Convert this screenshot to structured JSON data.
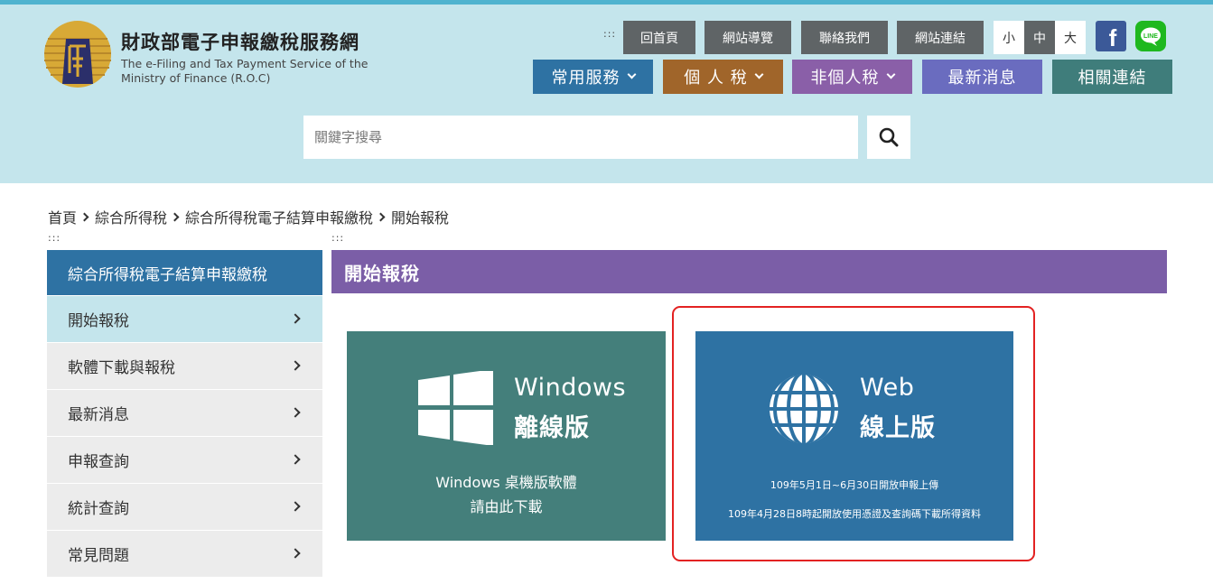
{
  "brand": {
    "title": "財政部電子申報繳稅服務網",
    "subtitle": "The e-Filing and Tax Payment Service of the Ministry of Finance (R.O.C)",
    "logo_text": "財"
  },
  "accesskeys": {
    "top": ":::",
    "left": ":::",
    "content": ":::"
  },
  "utility_nav": [
    "回首頁",
    "網站導覽",
    "聯絡我們",
    "網站連結"
  ],
  "font_size": {
    "small": "小",
    "medium": "中",
    "large": "大"
  },
  "social": {
    "facebook": "f",
    "line": "LINE"
  },
  "main_nav": [
    {
      "label": "常用服務",
      "color": "#2e72a3",
      "dropdown": true
    },
    {
      "label": "個 人 稅",
      "color": "#a0652a",
      "dropdown": true
    },
    {
      "label": "非個人稅",
      "color": "#8a5fa8",
      "dropdown": true
    },
    {
      "label": "最新消息",
      "color": "#6a6cbf",
      "dropdown": false
    },
    {
      "label": "相關連結",
      "color": "#3f7d7b",
      "dropdown": false
    }
  ],
  "search": {
    "placeholder": "關鍵字搜尋",
    "icon": "search-icon"
  },
  "breadcrumb": [
    "首頁",
    "綜合所得稅",
    "綜合所得稅電子結算申報繳稅",
    "開始報稅"
  ],
  "sidebar": {
    "heading": "綜合所得稅電子結算申報繳稅",
    "items": [
      "開始報稅",
      "軟體下載與報稅",
      "最新消息",
      "申報查詢",
      "統計查詢",
      "常見問題"
    ],
    "active_index": 0
  },
  "content": {
    "title": "開始報稅",
    "cards": {
      "windows": {
        "label1": "Windows",
        "label2": "離線版",
        "desc1": "Windows 桌機版軟體",
        "desc2": "請由此下載",
        "icon": "windows-logo-icon"
      },
      "web": {
        "label1": "Web",
        "label2": "線上版",
        "note1": "109年5月1日~6月30日開放申報上傳",
        "note2": "109年4月28日8時起開放使用憑證及查詢碼下載所得資料",
        "icon": "globe-icon"
      }
    }
  },
  "colors": {
    "header_bg": "#c4e5ec",
    "top_line": "#4fb3cf",
    "utility_btn": "#5f6466",
    "sidebar_head": "#2e72a3",
    "sidebar_item": "#ececec",
    "content_title": "#7b5ea7",
    "windows_card": "#447f7b",
    "web_card": "#2e72a3",
    "highlight": "#e32222"
  }
}
